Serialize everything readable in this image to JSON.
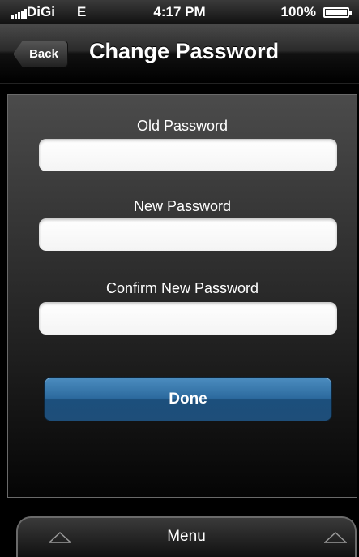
{
  "status_bar": {
    "carrier": "DiGi",
    "network": "E",
    "time": "4:17 PM",
    "battery": "100%"
  },
  "nav": {
    "back_label": "Back",
    "title": "Change Password"
  },
  "form": {
    "old_password_label": "Old Password",
    "old_password_value": "",
    "new_password_label": "New Password",
    "new_password_value": "",
    "confirm_password_label": "Confirm New Password",
    "confirm_password_value": "",
    "done_label": "Done"
  },
  "menu": {
    "label": "Menu",
    "left_icon": "triangle-up-icon",
    "right_icon": "triangle-up-icon"
  },
  "colors": {
    "done_button": "#2c6a9e",
    "background": "#000000"
  }
}
